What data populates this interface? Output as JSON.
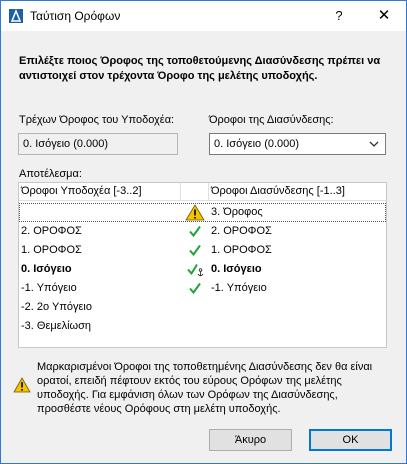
{
  "window": {
    "title": "Ταύτιση Ορόφων"
  },
  "titlebar": {
    "help_label": "?",
    "close_label": "✕"
  },
  "intro": "Επιλέξτε ποιος Όροφος της τοποθετούμενης Διασύνδεσης πρέπει να αντιστοιχεί στον τρέχοντα Όροφο της μελέτης υποδοχής.",
  "current_floor": {
    "label": "Τρέχων Όροφος του Υποδοχέα:",
    "value": "0. Ισόγειο (0.000)"
  },
  "link_floors": {
    "label": "Όροφοι της Διασύνδεσης:",
    "selected": "0. Ισόγειο (0.000)"
  },
  "result": {
    "label": "Αποτέλεσμα:",
    "col_host": "Όροφοι Υποδοχέα [-3..2]",
    "col_link": "Όροφοι Διασύνδεσης [-1..3]",
    "rows": [
      {
        "host": "",
        "status": "warning",
        "link": "3. Όροφος"
      },
      {
        "host": "2. ΟΡΟΦΟΣ",
        "status": "check",
        "link": "2. ΟΡΟΦΟΣ"
      },
      {
        "host": "1. ΟΡΟΦΟΣ",
        "status": "check",
        "link": "1. ΟΡΟΦΟΣ"
      },
      {
        "host": "0. Ισόγειο",
        "status": "check-anchor",
        "link": "0. Ισόγειο"
      },
      {
        "host": "-1. Υπόγειο",
        "status": "check",
        "link": "-1. Υπόγειο"
      },
      {
        "host": "-2. 2ο Υπόγειο",
        "status": "",
        "link": ""
      },
      {
        "host": "-3. Θεμελίωση",
        "status": "",
        "link": ""
      }
    ]
  },
  "note": "Μαρκαρισμένοι Όροφοι της τοποθετημένης Διασύνδεσης δεν θα είναι ορατοί, επειδή πέφτουν εκτός του εύρους Ορόφων της μελέτης υποδοχής. Για εμφάνιση όλων των Ορόφων της Διασύνδεσης, προσθέστε νέους Ορόφους στη μελέτη υποδοχής.",
  "buttons": {
    "cancel": "Άκυρο",
    "ok": "OK"
  },
  "colors": {
    "accent": "#0078d7",
    "check": "#22a33a",
    "warning": "#f5c400"
  }
}
